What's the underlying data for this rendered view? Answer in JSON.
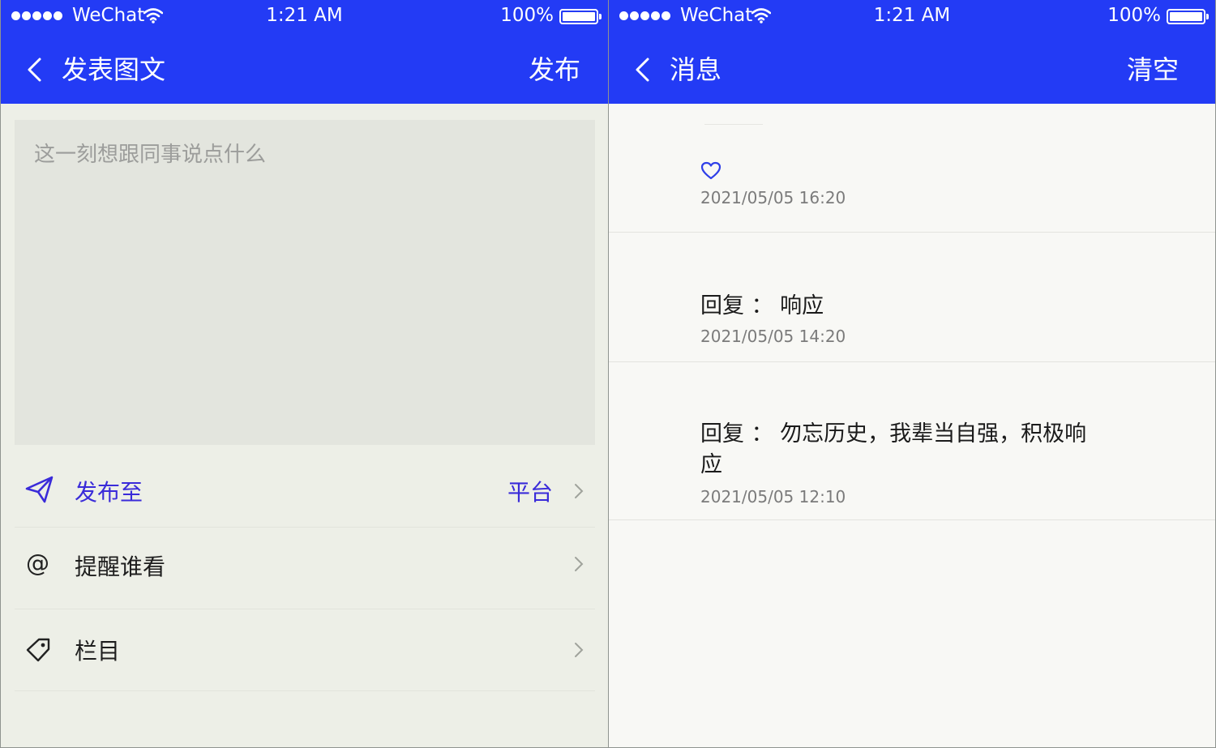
{
  "status_bar": {
    "carrier": "WeChat",
    "time": "1:21 AM",
    "battery": "100%"
  },
  "left": {
    "header": {
      "title": "发表图文",
      "action": "发布"
    },
    "editor": {
      "placeholder": "这一刻想跟同事说点什么"
    },
    "rows": [
      {
        "label": "发布至",
        "value": "平台",
        "icon": "send-icon"
      },
      {
        "label": "提醒谁看",
        "value": "",
        "icon": "at-icon"
      },
      {
        "label": "栏目",
        "value": "",
        "icon": "tag-icon"
      }
    ],
    "at_symbol": "@",
    "accent": "#3a2bd9"
  },
  "right": {
    "header": {
      "title": "消息",
      "action": "清空"
    },
    "messages": [
      {
        "content": "",
        "time": "2021/05/05 16:20",
        "icon": "heart-icon"
      },
      {
        "content": "回复      ： 响应",
        "time": "2021/05/05 14:20"
      },
      {
        "content": "回复       ： 勿忘历史，我辈当自强，积极响应",
        "time": "2021/05/05 12:10"
      }
    ]
  },
  "colors": {
    "header_bg": "#233bf5",
    "left_bg": "#edefe7",
    "right_bg": "#f8f8f5"
  }
}
